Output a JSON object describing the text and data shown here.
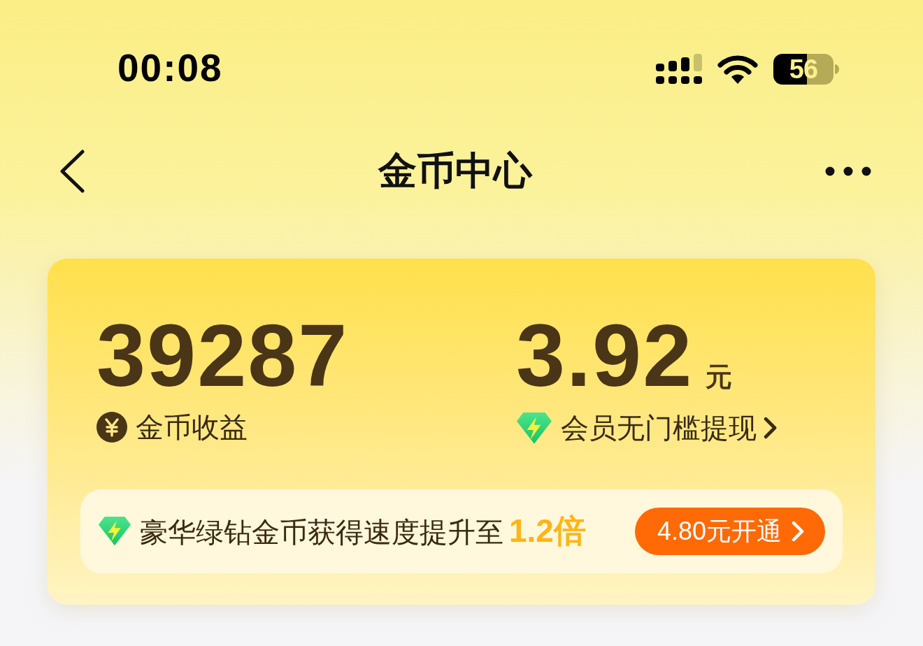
{
  "status_bar": {
    "time": "00:08",
    "battery": "56"
  },
  "nav": {
    "title": "金币中心"
  },
  "summary": {
    "coins": {
      "value": "39287",
      "label": "金币收益"
    },
    "cash": {
      "value": "3.92",
      "unit": "元",
      "label": "会员无门槛提现"
    }
  },
  "promo": {
    "text": "豪华绿钻金币获得速度提升至**1.2倍**",
    "button": "4.80元开通"
  }
}
